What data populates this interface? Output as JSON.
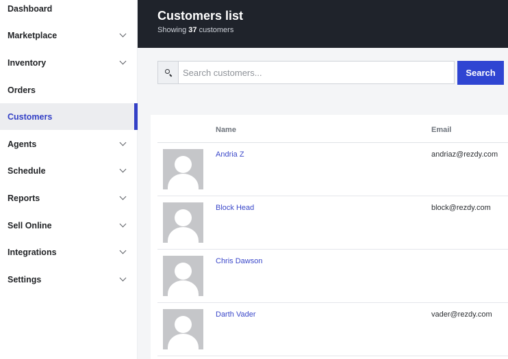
{
  "sidebar": {
    "items": [
      {
        "label": "Dashboard",
        "has_chevron": false,
        "active": false
      },
      {
        "label": "Marketplace",
        "has_chevron": true,
        "active": false
      },
      {
        "label": "Inventory",
        "has_chevron": true,
        "active": false
      },
      {
        "label": "Orders",
        "has_chevron": false,
        "active": false
      },
      {
        "label": "Customers",
        "has_chevron": false,
        "active": true
      },
      {
        "label": "Agents",
        "has_chevron": true,
        "active": false
      },
      {
        "label": "Schedule",
        "has_chevron": true,
        "active": false
      },
      {
        "label": "Reports",
        "has_chevron": true,
        "active": false
      },
      {
        "label": "Sell Online",
        "has_chevron": true,
        "active": false
      },
      {
        "label": "Integrations",
        "has_chevron": true,
        "active": false
      },
      {
        "label": "Settings",
        "has_chevron": true,
        "active": false
      }
    ]
  },
  "header": {
    "title": "Customers list",
    "subtitle_prefix": "Showing",
    "count": "37",
    "subtitle_suffix": "customers"
  },
  "search": {
    "placeholder": "Search customers...",
    "value": "",
    "button_label": "Search",
    "icon": "search-icon"
  },
  "table": {
    "columns": [
      "Name",
      "Email"
    ],
    "rows": [
      {
        "name": "Andria Z",
        "email": "andriaz@rezdy.com"
      },
      {
        "name": "Block Head",
        "email": "block@rezdy.com"
      },
      {
        "name": "Chris Dawson",
        "email": ""
      },
      {
        "name": "Darth Vader",
        "email": "vader@rezdy.com"
      }
    ]
  },
  "colors": {
    "accent": "#3340c6",
    "header_bg": "#1f232b",
    "search_button": "#2f45d2"
  }
}
